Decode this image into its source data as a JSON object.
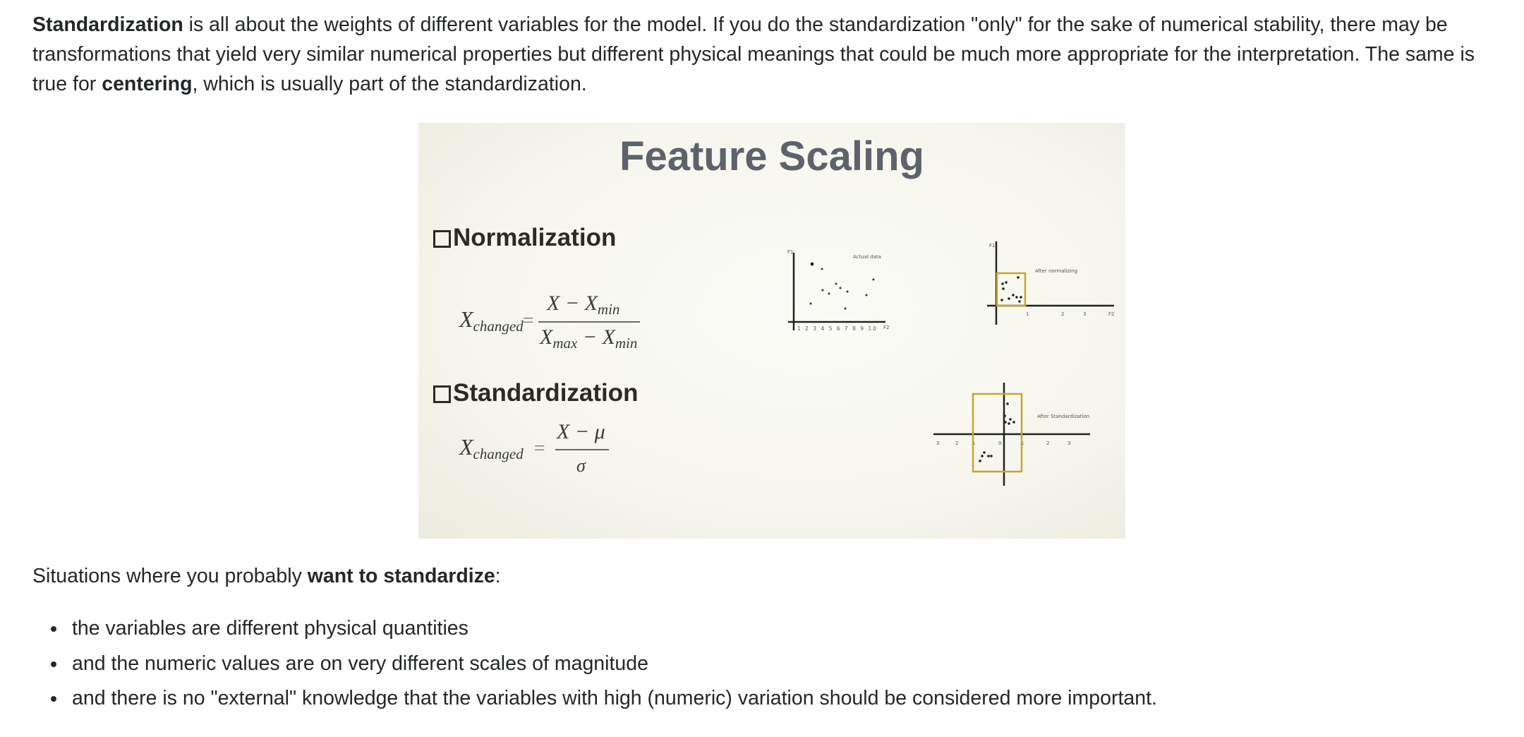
{
  "intro": {
    "term_standardization": "Standardization",
    "text_1": " is all about the weights of different variables for the model. If you do the standardization \"only\" for the sake of numerical stability, there may be transformations that yield very similar numerical properties but different physical meanings that could be much more appropriate for the interpretation. The same is true for ",
    "term_centering": "centering",
    "text_2": ", which is usually part of the standardization."
  },
  "figure": {
    "title": "Feature Scaling",
    "normalization_heading": "Normalization",
    "standardization_heading": "Standardization",
    "norm_formula": {
      "lhs_var": "X",
      "lhs_sub": "changed",
      "num_var": "X − X",
      "num_sub": "min",
      "den_var_a": "X",
      "den_sub_a": "max",
      "den_mid": " − X",
      "den_sub_b": "min"
    },
    "std_formula": {
      "lhs_var": "X",
      "lhs_sub": "changed",
      "numerator": "X − μ",
      "denominator": "σ"
    },
    "plot_actual": {
      "label": "Actual data",
      "y_axis": "F1",
      "x_axis": "F2",
      "ticks": "1 2 3 4 5 6 7 8 9 10"
    },
    "plot_normalized": {
      "label": "After normalizing",
      "y_axis": "F1",
      "x_axis": "F2",
      "ticks": [
        "1",
        "2",
        "3"
      ]
    },
    "plot_standardized": {
      "label": "After Standardization",
      "ticks_left": [
        "3",
        "2",
        "1"
      ],
      "tick_zero": "0",
      "ticks_right": [
        "1",
        "2",
        "3"
      ]
    },
    "box_color": "#c8a52e"
  },
  "situations": {
    "text_before": "Situations where you probably ",
    "emphasis": "want to standardize",
    "text_after": ":"
  },
  "bullets": [
    "the variables are different physical quantities",
    "and the numeric values are on very different scales of magnitude",
    "and there is no \"external\" knowledge that the variables with high (numeric) variation should be considered more important."
  ]
}
